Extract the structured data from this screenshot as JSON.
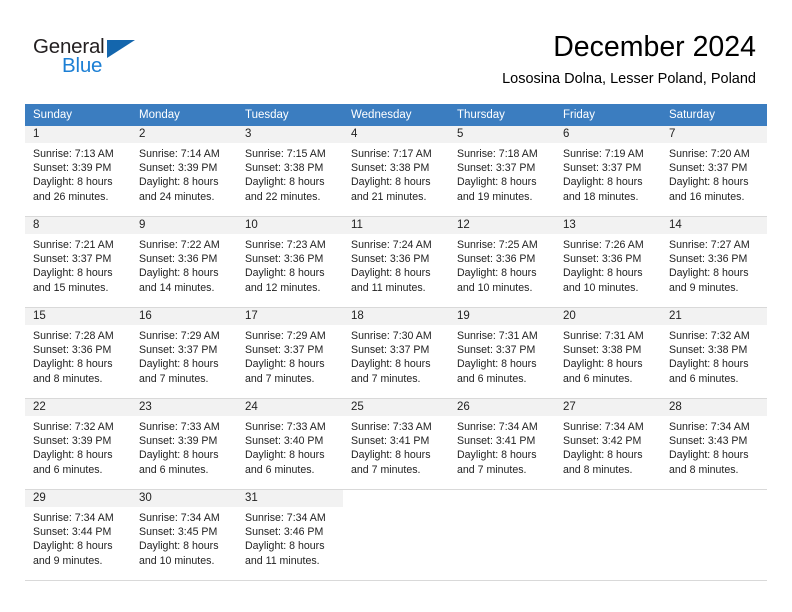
{
  "brand": {
    "name_part1": "General",
    "name_part2": "Blue",
    "triangle_icon": "triangle-icon",
    "colors": {
      "general_text": "#231f20",
      "blue_text": "#1c7fd4",
      "triangle": "#1466ad"
    }
  },
  "header": {
    "title": "December 2024",
    "subtitle": "Lososina Dolna, Lesser Poland, Poland"
  },
  "calendar": {
    "header_background": "#3b7dc0",
    "daynum_background": "#f2f2f2",
    "weekdays": [
      "Sunday",
      "Monday",
      "Tuesday",
      "Wednesday",
      "Thursday",
      "Friday",
      "Saturday"
    ],
    "weeks": [
      [
        {
          "day": "1",
          "sunrise": "Sunrise: 7:13 AM",
          "sunset": "Sunset: 3:39 PM",
          "daylight_line1": "Daylight: 8 hours",
          "daylight_line2": "and 26 minutes."
        },
        {
          "day": "2",
          "sunrise": "Sunrise: 7:14 AM",
          "sunset": "Sunset: 3:39 PM",
          "daylight_line1": "Daylight: 8 hours",
          "daylight_line2": "and 24 minutes."
        },
        {
          "day": "3",
          "sunrise": "Sunrise: 7:15 AM",
          "sunset": "Sunset: 3:38 PM",
          "daylight_line1": "Daylight: 8 hours",
          "daylight_line2": "and 22 minutes."
        },
        {
          "day": "4",
          "sunrise": "Sunrise: 7:17 AM",
          "sunset": "Sunset: 3:38 PM",
          "daylight_line1": "Daylight: 8 hours",
          "daylight_line2": "and 21 minutes."
        },
        {
          "day": "5",
          "sunrise": "Sunrise: 7:18 AM",
          "sunset": "Sunset: 3:37 PM",
          "daylight_line1": "Daylight: 8 hours",
          "daylight_line2": "and 19 minutes."
        },
        {
          "day": "6",
          "sunrise": "Sunrise: 7:19 AM",
          "sunset": "Sunset: 3:37 PM",
          "daylight_line1": "Daylight: 8 hours",
          "daylight_line2": "and 18 minutes."
        },
        {
          "day": "7",
          "sunrise": "Sunrise: 7:20 AM",
          "sunset": "Sunset: 3:37 PM",
          "daylight_line1": "Daylight: 8 hours",
          "daylight_line2": "and 16 minutes."
        }
      ],
      [
        {
          "day": "8",
          "sunrise": "Sunrise: 7:21 AM",
          "sunset": "Sunset: 3:37 PM",
          "daylight_line1": "Daylight: 8 hours",
          "daylight_line2": "and 15 minutes."
        },
        {
          "day": "9",
          "sunrise": "Sunrise: 7:22 AM",
          "sunset": "Sunset: 3:36 PM",
          "daylight_line1": "Daylight: 8 hours",
          "daylight_line2": "and 14 minutes."
        },
        {
          "day": "10",
          "sunrise": "Sunrise: 7:23 AM",
          "sunset": "Sunset: 3:36 PM",
          "daylight_line1": "Daylight: 8 hours",
          "daylight_line2": "and 12 minutes."
        },
        {
          "day": "11",
          "sunrise": "Sunrise: 7:24 AM",
          "sunset": "Sunset: 3:36 PM",
          "daylight_line1": "Daylight: 8 hours",
          "daylight_line2": "and 11 minutes."
        },
        {
          "day": "12",
          "sunrise": "Sunrise: 7:25 AM",
          "sunset": "Sunset: 3:36 PM",
          "daylight_line1": "Daylight: 8 hours",
          "daylight_line2": "and 10 minutes."
        },
        {
          "day": "13",
          "sunrise": "Sunrise: 7:26 AM",
          "sunset": "Sunset: 3:36 PM",
          "daylight_line1": "Daylight: 8 hours",
          "daylight_line2": "and 10 minutes."
        },
        {
          "day": "14",
          "sunrise": "Sunrise: 7:27 AM",
          "sunset": "Sunset: 3:36 PM",
          "daylight_line1": "Daylight: 8 hours",
          "daylight_line2": "and 9 minutes."
        }
      ],
      [
        {
          "day": "15",
          "sunrise": "Sunrise: 7:28 AM",
          "sunset": "Sunset: 3:36 PM",
          "daylight_line1": "Daylight: 8 hours",
          "daylight_line2": "and 8 minutes."
        },
        {
          "day": "16",
          "sunrise": "Sunrise: 7:29 AM",
          "sunset": "Sunset: 3:37 PM",
          "daylight_line1": "Daylight: 8 hours",
          "daylight_line2": "and 7 minutes."
        },
        {
          "day": "17",
          "sunrise": "Sunrise: 7:29 AM",
          "sunset": "Sunset: 3:37 PM",
          "daylight_line1": "Daylight: 8 hours",
          "daylight_line2": "and 7 minutes."
        },
        {
          "day": "18",
          "sunrise": "Sunrise: 7:30 AM",
          "sunset": "Sunset: 3:37 PM",
          "daylight_line1": "Daylight: 8 hours",
          "daylight_line2": "and 7 minutes."
        },
        {
          "day": "19",
          "sunrise": "Sunrise: 7:31 AM",
          "sunset": "Sunset: 3:37 PM",
          "daylight_line1": "Daylight: 8 hours",
          "daylight_line2": "and 6 minutes."
        },
        {
          "day": "20",
          "sunrise": "Sunrise: 7:31 AM",
          "sunset": "Sunset: 3:38 PM",
          "daylight_line1": "Daylight: 8 hours",
          "daylight_line2": "and 6 minutes."
        },
        {
          "day": "21",
          "sunrise": "Sunrise: 7:32 AM",
          "sunset": "Sunset: 3:38 PM",
          "daylight_line1": "Daylight: 8 hours",
          "daylight_line2": "and 6 minutes."
        }
      ],
      [
        {
          "day": "22",
          "sunrise": "Sunrise: 7:32 AM",
          "sunset": "Sunset: 3:39 PM",
          "daylight_line1": "Daylight: 8 hours",
          "daylight_line2": "and 6 minutes."
        },
        {
          "day": "23",
          "sunrise": "Sunrise: 7:33 AM",
          "sunset": "Sunset: 3:39 PM",
          "daylight_line1": "Daylight: 8 hours",
          "daylight_line2": "and 6 minutes."
        },
        {
          "day": "24",
          "sunrise": "Sunrise: 7:33 AM",
          "sunset": "Sunset: 3:40 PM",
          "daylight_line1": "Daylight: 8 hours",
          "daylight_line2": "and 6 minutes."
        },
        {
          "day": "25",
          "sunrise": "Sunrise: 7:33 AM",
          "sunset": "Sunset: 3:41 PM",
          "daylight_line1": "Daylight: 8 hours",
          "daylight_line2": "and 7 minutes."
        },
        {
          "day": "26",
          "sunrise": "Sunrise: 7:34 AM",
          "sunset": "Sunset: 3:41 PM",
          "daylight_line1": "Daylight: 8 hours",
          "daylight_line2": "and 7 minutes."
        },
        {
          "day": "27",
          "sunrise": "Sunrise: 7:34 AM",
          "sunset": "Sunset: 3:42 PM",
          "daylight_line1": "Daylight: 8 hours",
          "daylight_line2": "and 8 minutes."
        },
        {
          "day": "28",
          "sunrise": "Sunrise: 7:34 AM",
          "sunset": "Sunset: 3:43 PM",
          "daylight_line1": "Daylight: 8 hours",
          "daylight_line2": "and 8 minutes."
        }
      ],
      [
        {
          "day": "29",
          "sunrise": "Sunrise: 7:34 AM",
          "sunset": "Sunset: 3:44 PM",
          "daylight_line1": "Daylight: 8 hours",
          "daylight_line2": "and 9 minutes."
        },
        {
          "day": "30",
          "sunrise": "Sunrise: 7:34 AM",
          "sunset": "Sunset: 3:45 PM",
          "daylight_line1": "Daylight: 8 hours",
          "daylight_line2": "and 10 minutes."
        },
        {
          "day": "31",
          "sunrise": "Sunrise: 7:34 AM",
          "sunset": "Sunset: 3:46 PM",
          "daylight_line1": "Daylight: 8 hours",
          "daylight_line2": "and 11 minutes."
        },
        {
          "day": "",
          "sunrise": "",
          "sunset": "",
          "daylight_line1": "",
          "daylight_line2": ""
        },
        {
          "day": "",
          "sunrise": "",
          "sunset": "",
          "daylight_line1": "",
          "daylight_line2": ""
        },
        {
          "day": "",
          "sunrise": "",
          "sunset": "",
          "daylight_line1": "",
          "daylight_line2": ""
        },
        {
          "day": "",
          "sunrise": "",
          "sunset": "",
          "daylight_line1": "",
          "daylight_line2": ""
        }
      ]
    ]
  }
}
